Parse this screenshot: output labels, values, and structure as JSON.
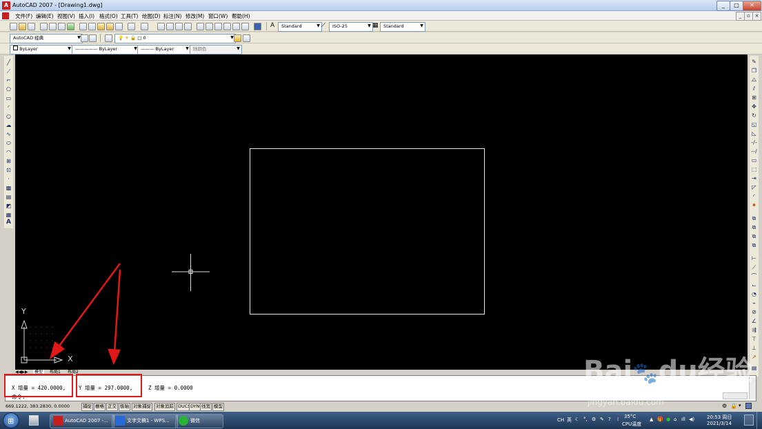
{
  "window": {
    "title": "AutoCAD 2007 - [Drawing1.dwg]",
    "app_icon": "A"
  },
  "window_buttons": {
    "minimize": "_",
    "maximize": "□",
    "close": "✕"
  },
  "doc_buttons": {
    "minimize": "_",
    "restore": "▫",
    "close": "×"
  },
  "menu": [
    "文件(F)",
    "编辑(E)",
    "视图(V)",
    "插入(I)",
    "格式(O)",
    "工具(T)",
    "绘图(D)",
    "标注(N)",
    "修改(M)",
    "窗口(W)",
    "帮助(H)"
  ],
  "toolbar": {
    "text_style": "Standard",
    "dim_style": "ISO-25",
    "table_style": "Standard",
    "workspace": "AutoCAD 经典",
    "layer": "0",
    "color": "ByLayer",
    "linetype": "ByLayer",
    "lineweight": "ByLayer",
    "plot_style": "随颜色"
  },
  "ucs": {
    "x_label": "X",
    "y_label": "Y"
  },
  "tabs": [
    "模型",
    "布局1",
    "布局2"
  ],
  "command": {
    "x_delta": "X 增量 = 420.0000,",
    "y_delta": "Y 增量 = 297.0000,",
    "z_delta": "Z 增量 = 0.0000",
    "prompt": "命令:"
  },
  "status": {
    "coords": "669.1222, 383.2830, 0.0000",
    "buttons": [
      "捕捉",
      "栅格",
      "正交",
      "极轴",
      "对象捕捉",
      "对象追踪",
      "DUCS",
      "DYN",
      "线宽",
      "模型"
    ]
  },
  "taskbar": {
    "items": [
      "AutoCAD 2007 -...",
      "文字文稿1 - WPS...",
      "微信"
    ],
    "temperature": "35°C",
    "temperature_label": "CPU温度",
    "language": "CH",
    "ime": "英",
    "time": "20:53 周日",
    "date": "2021/3/14"
  },
  "watermark": {
    "brand": "Bai",
    "brand2": "du",
    "suffix": "经验",
    "url": "jingyan.baidu.com"
  },
  "colors": {
    "annotation_red": "#e01818",
    "canvas": "#000000",
    "geometry": "#ffffff"
  }
}
